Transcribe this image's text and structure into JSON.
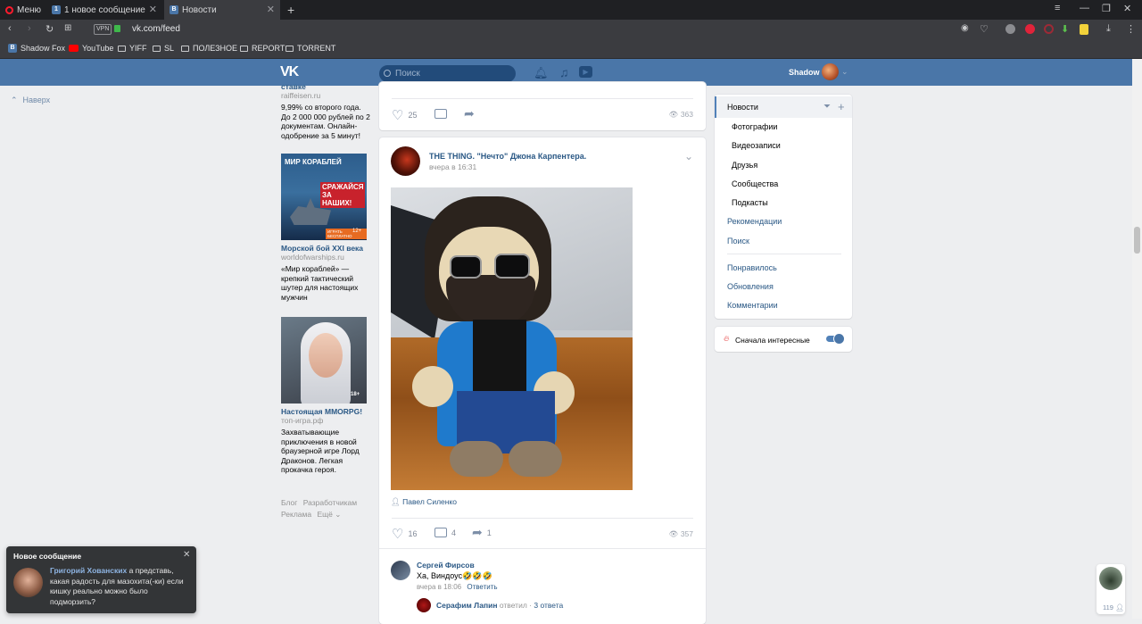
{
  "browser": {
    "menu_label": "Меню",
    "tabs": [
      {
        "label": "1 новое сообщение",
        "favicon": "1"
      },
      {
        "label": "Новости",
        "favicon": "vk"
      }
    ],
    "new_tab": "+",
    "vpn_label": "VPN",
    "url": "vk.com/feed",
    "bookmarks": [
      "Shadow Fox",
      "YouTube",
      "YIFF",
      "SL",
      "ПОЛЕЗНОЕ",
      "REPORT",
      "TORRENT"
    ]
  },
  "vk": {
    "logo": "VK",
    "search_placeholder": "Поиск",
    "user_name": "Shadow",
    "scroll_top": "Наверх"
  },
  "ads": [
    {
      "title": "ставке",
      "url": "raiffeisen.ru",
      "text": "9,99% со второго года. До 2 000 000 рублей по 2 документам. Онлайн-одобрение за 5 минут!"
    },
    {
      "banner": "МИР КОРАБЛЕЙ",
      "banner_sub": "СРАЖАЙСЯ ЗА НАШИХ!",
      "banner_btn": "ИГРАТЬ БЕСПЛАТНО",
      "age": "12+",
      "title": "Морской бой XXI века",
      "url": "worldofwarships.ru",
      "text": "«Мир кораблей» — крепкий тактический шутер для настоящих мужчин"
    },
    {
      "age": "18+",
      "title": "Настоящая MMORPG!",
      "url": "топ-игра.рф",
      "text": "Захватывающие приключения в новой браузерной игре Лорд Драконов. Легкая прокачка героя."
    }
  ],
  "footer_links": [
    "Блог",
    "Разработчикам",
    "Реклама",
    "Ещё"
  ],
  "post_prev": {
    "likes": "25",
    "views": "363"
  },
  "post": {
    "author": "THE THING. \"Нечто\" Джона Карпентера.",
    "time": "вчера в 16:31",
    "photo_author": "Павел Силенко",
    "likes": "16",
    "comments": "4",
    "shares": "1",
    "views": "357"
  },
  "comments": [
    {
      "author": "Сергей Фирсов",
      "text": "Ха, Виндоус🤣🤣🤣",
      "time": "вчера в 18:06",
      "reply": "Ответить"
    }
  ],
  "replies_line": {
    "author": "Серафим Лапин",
    "action": "ответил",
    "count": "3 ответа"
  },
  "right_menu": {
    "main": "Новости",
    "sub": [
      "Фотографии",
      "Видеозаписи",
      "Друзья",
      "Сообщества",
      "Подкасты"
    ],
    "other": [
      "Рекомендации",
      "Поиск"
    ],
    "bottom": [
      "Понравилось",
      "Обновления",
      "Комментарии"
    ],
    "toggle_label": "Сначала интересные",
    "toggle_on": true
  },
  "notification": {
    "title": "Новое сообщение",
    "sender": "Григорий Хованских",
    "text": "а представь, какая радость для мазохита(-ки) если кишку реально можно было подморзить?"
  },
  "friends_widget": {
    "count": "119"
  },
  "colors": {
    "vk_blue": "#4a76a8",
    "link": "#2a5885",
    "bg": "#edeef0"
  }
}
